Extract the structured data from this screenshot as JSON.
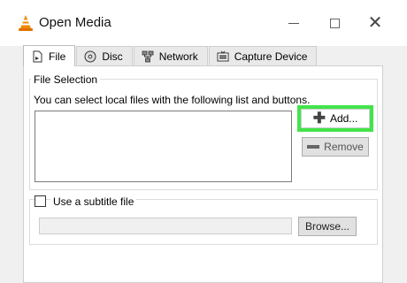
{
  "window": {
    "title": "Open Media",
    "minimize_icon": "minimize-icon",
    "maximize_icon": "maximize-icon",
    "close_icon": "close-icon",
    "app_icon": "vlc-cone-icon"
  },
  "tabs": [
    {
      "label": "File",
      "icon": "file-icon",
      "active": true
    },
    {
      "label": "Disc",
      "icon": "disc-icon",
      "active": false
    },
    {
      "label": "Network",
      "icon": "network-icon",
      "active": false
    },
    {
      "label": "Capture Device",
      "icon": "capture-device-icon",
      "active": false
    }
  ],
  "file_selection": {
    "title": "File Selection",
    "description": "You can select local files with the following list and buttons.",
    "add_label": "Add...",
    "remove_label": "Remove",
    "highlight_color": "#43e34a"
  },
  "subtitle": {
    "checkbox_label": "Use a subtitle file",
    "checked": false,
    "browse_label": "Browse..."
  }
}
